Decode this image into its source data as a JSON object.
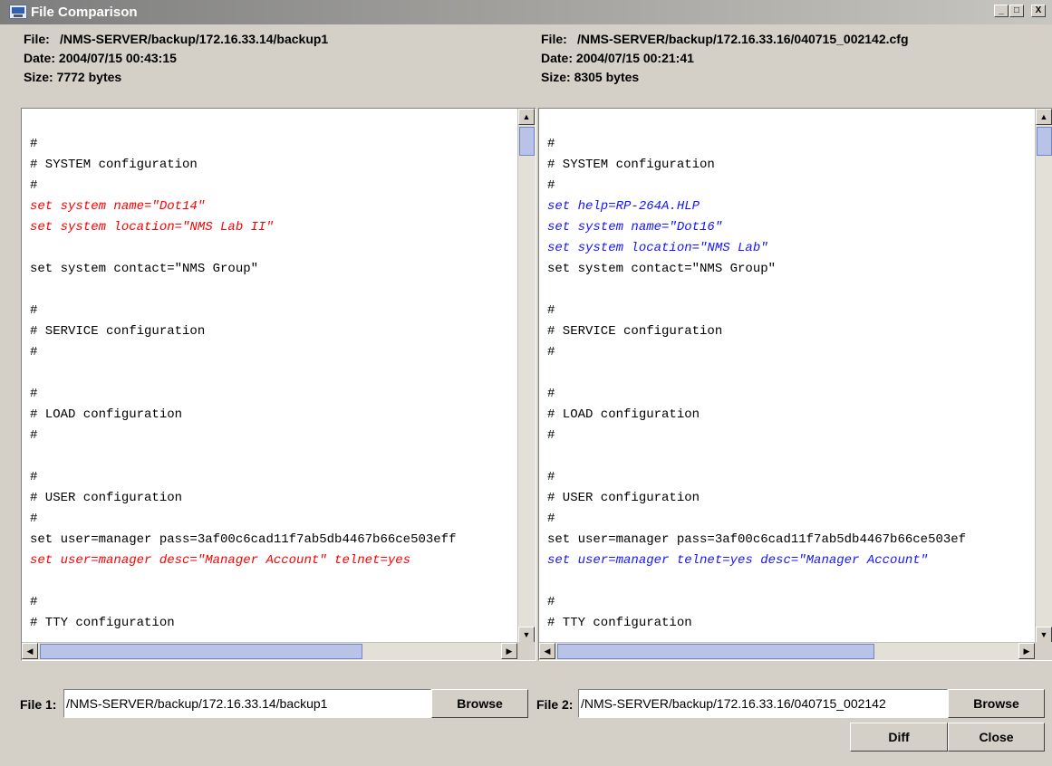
{
  "window": {
    "title": "File Comparison",
    "controls": {
      "minimize": "_",
      "maximize": "□",
      "close": "X"
    }
  },
  "left": {
    "file_label": "File:",
    "file_value": "/NMS-SERVER/backup/172.16.33.14/backup1",
    "date_label": "Date:",
    "date_value": "2004/07/15  00:43:15",
    "size_label": "Size:",
    "size_value": "7772 bytes",
    "lines": [
      {
        "text": "#",
        "kind": "normal"
      },
      {
        "text": "# SYSTEM configuration",
        "kind": "normal"
      },
      {
        "text": "#",
        "kind": "normal"
      },
      {
        "text": "set system name=\"Dot14\"",
        "kind": "removed"
      },
      {
        "text": "set system location=\"NMS Lab II\"",
        "kind": "removed"
      },
      {
        "text": "",
        "kind": "normal"
      },
      {
        "text": "set system contact=\"NMS Group\"",
        "kind": "normal"
      },
      {
        "text": "",
        "kind": "normal"
      },
      {
        "text": "#",
        "kind": "normal"
      },
      {
        "text": "# SERVICE configuration",
        "kind": "normal"
      },
      {
        "text": "#",
        "kind": "normal"
      },
      {
        "text": "",
        "kind": "normal"
      },
      {
        "text": "#",
        "kind": "normal"
      },
      {
        "text": "# LOAD configuration",
        "kind": "normal"
      },
      {
        "text": "#",
        "kind": "normal"
      },
      {
        "text": "",
        "kind": "normal"
      },
      {
        "text": "#",
        "kind": "normal"
      },
      {
        "text": "# USER configuration",
        "kind": "normal"
      },
      {
        "text": "#",
        "kind": "normal"
      },
      {
        "text": "set user=manager pass=3af00c6cad11f7ab5db4467b66ce503eff",
        "kind": "normal"
      },
      {
        "text": "set user=manager desc=\"Manager Account\" telnet=yes",
        "kind": "removed"
      },
      {
        "text": "",
        "kind": "normal"
      },
      {
        "text": "#",
        "kind": "normal"
      },
      {
        "text": "# TTY configuration",
        "kind": "normal"
      }
    ],
    "field_label": "File 1:",
    "field_value": "/NMS-SERVER/backup/172.16.33.14/backup1",
    "browse_label": "Browse"
  },
  "right": {
    "file_label": "File:",
    "file_value": "/NMS-SERVER/backup/172.16.33.16/040715_002142.cfg",
    "date_label": "Date:",
    "date_value": "2004/07/15  00:21:41",
    "size_label": "Size:",
    "size_value": "8305 bytes",
    "lines": [
      {
        "text": "#",
        "kind": "normal"
      },
      {
        "text": "# SYSTEM configuration",
        "kind": "normal"
      },
      {
        "text": "#",
        "kind": "normal"
      },
      {
        "text": "set help=RP-264A.HLP",
        "kind": "added"
      },
      {
        "text": "set system name=\"Dot16\"",
        "kind": "added"
      },
      {
        "text": "set system location=\"NMS Lab\"",
        "kind": "added"
      },
      {
        "text": "set system contact=\"NMS Group\"",
        "kind": "normal"
      },
      {
        "text": "",
        "kind": "normal"
      },
      {
        "text": "#",
        "kind": "normal"
      },
      {
        "text": "# SERVICE configuration",
        "kind": "normal"
      },
      {
        "text": "#",
        "kind": "normal"
      },
      {
        "text": "",
        "kind": "normal"
      },
      {
        "text": "#",
        "kind": "normal"
      },
      {
        "text": "# LOAD configuration",
        "kind": "normal"
      },
      {
        "text": "#",
        "kind": "normal"
      },
      {
        "text": "",
        "kind": "normal"
      },
      {
        "text": "#",
        "kind": "normal"
      },
      {
        "text": "# USER configuration",
        "kind": "normal"
      },
      {
        "text": "#",
        "kind": "normal"
      },
      {
        "text": "set user=manager pass=3af00c6cad11f7ab5db4467b66ce503ef",
        "kind": "normal"
      },
      {
        "text": "set user=manager telnet=yes desc=\"Manager Account\"",
        "kind": "added"
      },
      {
        "text": "",
        "kind": "normal"
      },
      {
        "text": "#",
        "kind": "normal"
      },
      {
        "text": "# TTY configuration",
        "kind": "normal"
      }
    ],
    "field_label": "File 2:",
    "field_value": "/NMS-SERVER/backup/172.16.33.16/040715_002142",
    "browse_label": "Browse"
  },
  "buttons": {
    "diff": "Diff",
    "close": "Close"
  },
  "scrollbar_icons": {
    "up": "arrow-up-icon",
    "down": "arrow-down-icon",
    "left": "arrow-left-icon",
    "right": "arrow-right-icon"
  },
  "colors": {
    "removed": "#ff0000",
    "added": "#1515ff",
    "thumb": "#b9c3e8"
  }
}
